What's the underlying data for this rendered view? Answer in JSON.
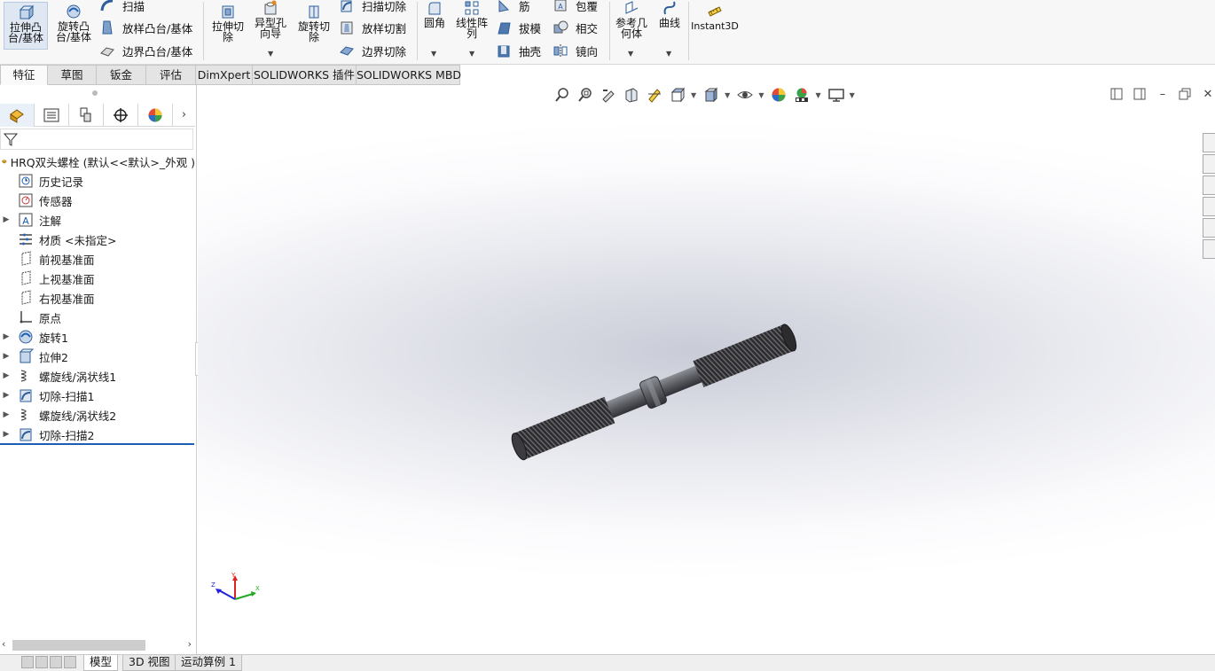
{
  "ribbon": {
    "extrude_boss": "拉伸凸台/基体",
    "revolve_boss": "旋转凸台/基体",
    "sweep": "扫描",
    "loft_boss": "放样凸台/基体",
    "boundary_boss": "边界凸台/基体",
    "extrude_cut": "拉伸切除",
    "hole_wizard": "异型孔向导",
    "revolve_cut": "旋转切除",
    "sweep_cut": "扫描切除",
    "loft_cut": "放样切割",
    "boundary_cut": "边界切除",
    "fillet": "圆角",
    "linear_pattern": "线性阵列",
    "rib": "筋",
    "draft": "拔模",
    "shell": "抽壳",
    "wrap": "包覆",
    "intersect": "相交",
    "mirror": "镜向",
    "ref_geometry": "参考几何体",
    "curves": "曲线",
    "instant3d": "Instant3D"
  },
  "cm_tabs": [
    "特征",
    "草图",
    "钣金",
    "评估",
    "DimXpert",
    "SOLIDWORKS 插件",
    "SOLIDWORKS MBD"
  ],
  "tree": {
    "root": "HRQ双头螺栓 (默认<<默认>_外观 )",
    "items": [
      {
        "label": "历史记录",
        "icon": "history-icon",
        "expandable": false
      },
      {
        "label": "传感器",
        "icon": "sensor-icon",
        "expandable": false
      },
      {
        "label": "注解",
        "icon": "annotation-icon",
        "expandable": true
      },
      {
        "label": "材质 <未指定>",
        "icon": "material-icon",
        "expandable": false
      },
      {
        "label": "前视基准面",
        "icon": "plane-icon",
        "expandable": false
      },
      {
        "label": "上视基准面",
        "icon": "plane-icon",
        "expandable": false
      },
      {
        "label": "右视基准面",
        "icon": "plane-icon",
        "expandable": false
      },
      {
        "label": "原点",
        "icon": "origin-icon",
        "expandable": false
      },
      {
        "label": "旋转1",
        "icon": "revolve-feature-icon",
        "expandable": true
      },
      {
        "label": "拉伸2",
        "icon": "extrude-feature-icon",
        "expandable": true
      },
      {
        "label": "螺旋线/涡状线1",
        "icon": "helix-icon",
        "expandable": true
      },
      {
        "label": "切除-扫描1",
        "icon": "cut-sweep-icon",
        "expandable": true
      },
      {
        "label": "螺旋线/涡状线2",
        "icon": "helix-icon",
        "expandable": true
      },
      {
        "label": "切除-扫描2",
        "icon": "cut-sweep-icon",
        "expandable": true
      }
    ]
  },
  "bottom_tabs": {
    "model": "模型",
    "view3d": "3D 视图",
    "motion": "运动算例 1"
  },
  "triad": {
    "x": "X",
    "y": "Y",
    "z": "Z"
  },
  "colors": {
    "accent": "#1a5fb4",
    "thread": "#2f2f31",
    "shaft": "#5e6066"
  }
}
